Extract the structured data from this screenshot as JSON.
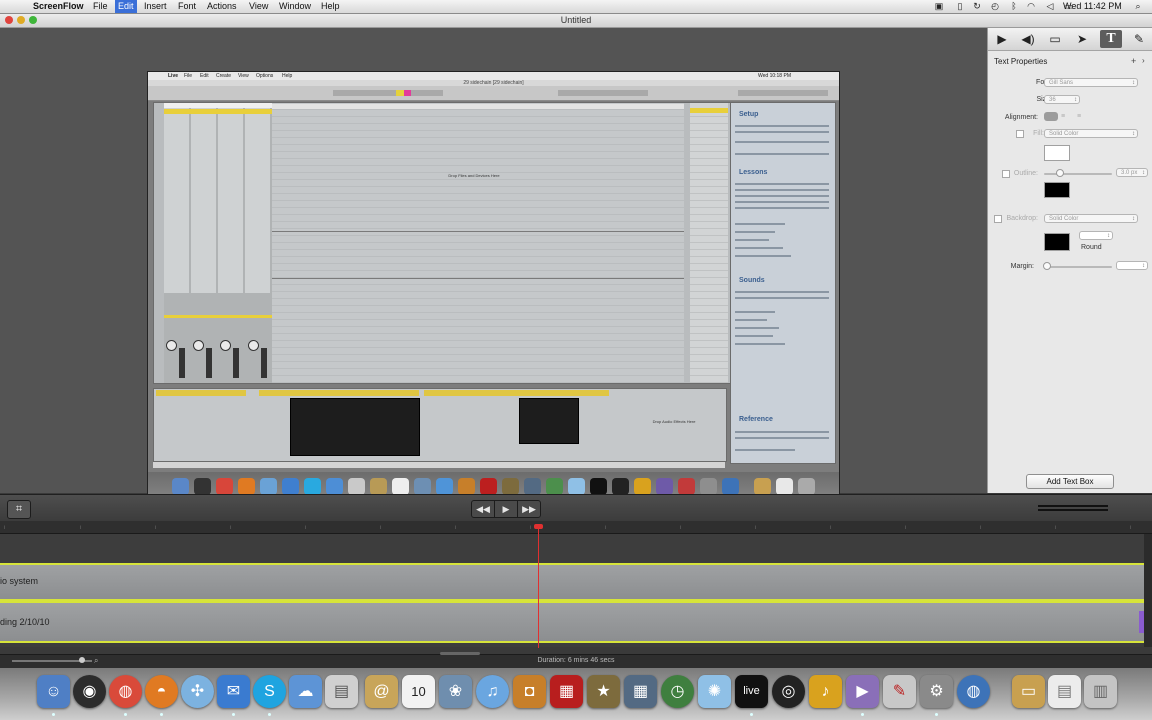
{
  "menubar": {
    "app_name": "ScreenFlow",
    "items": [
      "File",
      "Edit",
      "Insert",
      "Font",
      "Actions",
      "View",
      "Window",
      "Help"
    ],
    "active_item": "Edit",
    "clock": "Wed 11:42 PM"
  },
  "window": {
    "title": "Untitled"
  },
  "preview": {
    "app_menu": [
      "Live",
      "File",
      "Edit",
      "Create",
      "View",
      "Options",
      "Help"
    ],
    "doc_title": "29 sidechain  [29 sidechain]",
    "clock": "Wed 10:18 PM",
    "drop_files_msg": "Drop Files and Devices Here",
    "drop_effects_msg": "Drop Audio Effects Here",
    "help_sections": [
      "Setup",
      "Lessons",
      "Sounds",
      "Reference"
    ]
  },
  "inspector": {
    "title": "Text Properties",
    "font_label": "Font:",
    "font_value": "Gill Sans",
    "size_label": "Size:",
    "size_value": "36",
    "alignment_label": "Alignment:",
    "fill_label": "Fill:",
    "fill_value": "Solid Color",
    "outline_label": "Outline:",
    "outline_value": "3.0 px",
    "backdrop_label": "Backdrop:",
    "backdrop_value": "Solid Color",
    "round_label": "Round",
    "margin_label": "Margin:",
    "add_text_box_label": "Add Text Box",
    "colors": {
      "fill": "#ffffff",
      "outline": "#000000",
      "backdrop": "#000000"
    }
  },
  "timeline": {
    "tracks": [
      {
        "label": "io system"
      },
      {
        "label": "ding 2/10/10"
      }
    ],
    "duration": "Duration: 6 mins 46 secs",
    "playhead_color": "#e03030",
    "track_border_color": "#d7e43a"
  },
  "dock": {
    "icons": [
      "finder-icon",
      "dashboard-icon",
      "chrome-icon",
      "firefox-icon",
      "safari-icon",
      "mail-icon",
      "skype-icon",
      "ichat-icon",
      "preview-icon",
      "stamp-icon",
      "calendar-icon",
      "iphoto-icon",
      "itunes-icon",
      "photo-booth-icon",
      "photoshop-icon",
      "imovie-icon",
      "spaces-icon",
      "time-machine-icon",
      "colorsync-icon",
      "live-icon",
      "logic-icon",
      "garageband-icon",
      "screenflow-icon",
      "scripts-icon",
      "system-preferences-icon",
      "globe-icon",
      "folder-icon",
      "documents-icon",
      "trash-icon"
    ]
  }
}
